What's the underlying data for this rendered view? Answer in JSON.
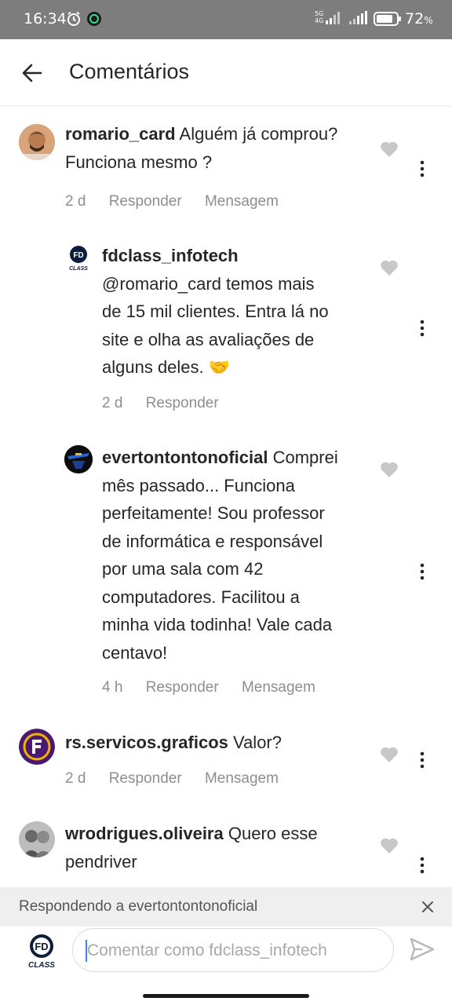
{
  "status_bar": {
    "time": "16:34",
    "network": "5G",
    "network_sub": "4G",
    "battery": "72",
    "battery_unit": "%"
  },
  "header": {
    "title": "Comentários"
  },
  "comments": [
    {
      "username": "romario_card",
      "text": "Alguém já comprou?",
      "text_line2": "Funciona mesmo ?",
      "time": "2 d",
      "reply": "Responder",
      "message": "Mensagem"
    },
    {
      "username": "fdclass_infotech",
      "lines": [
        "@romario_card temos mais",
        "de 15 mil clientes. Entra lá no",
        "site e olha as avaliações de",
        "alguns deles. 🤝"
      ],
      "time": "2 d",
      "reply": "Responder"
    },
    {
      "username": "evertontontonoficial",
      "first": "Comprei",
      "lines": [
        "mês passado... Funciona",
        "perfeitamente! Sou professor",
        "de informática e responsável",
        "por uma sala com 42",
        "computadores. Facilitou a",
        "minha vida todinha! Vale cada",
        "centavo!"
      ],
      "time": "4 h",
      "reply": "Responder",
      "message": "Mensagem"
    },
    {
      "username": "rs.servicos.graficos",
      "text": "Valor?",
      "time": "2 d",
      "reply": "Responder",
      "message": "Mensagem"
    },
    {
      "username": "wrodrigues.oliveira",
      "text": "Quero esse",
      "text_line2": "pendriver"
    }
  ],
  "reply_bar": {
    "text": "Respondendo a evertontontonoficial"
  },
  "composer": {
    "placeholder": "Comentar como fdclass_infotech",
    "value": ""
  },
  "logo_text": {
    "fd": "FD",
    "class": "CLASS"
  },
  "colors": {
    "status_bg": "#7d7d7d",
    "text": "#262626",
    "meta": "#8e8e8e",
    "reply_bar_bg": "#efefef"
  }
}
